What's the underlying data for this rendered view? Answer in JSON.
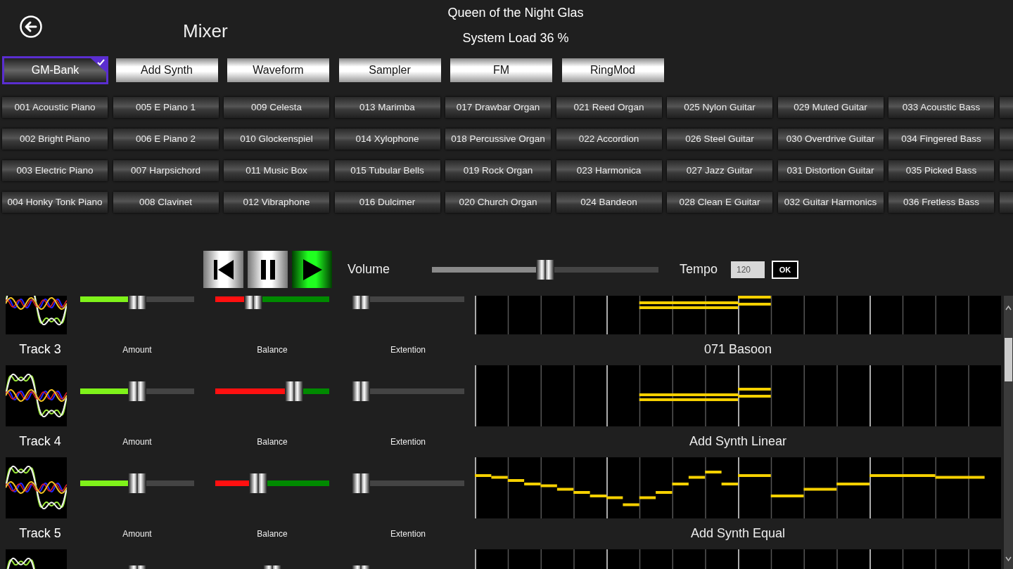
{
  "header": {
    "title": "Mixer",
    "song": "Queen of the Night Glas",
    "system_load": "System Load 36 %"
  },
  "tabs": [
    {
      "label": "GM-Bank",
      "selected": true
    },
    {
      "label": "Add Synth",
      "selected": false
    },
    {
      "label": "Waveform",
      "selected": false
    },
    {
      "label": "Sampler",
      "selected": false
    },
    {
      "label": "FM",
      "selected": false
    },
    {
      "label": "RingMod",
      "selected": false
    }
  ],
  "instrument_rows": [
    [
      "001 Acoustic Piano",
      "005 E Piano 1",
      "009 Celesta",
      "013 Marimba",
      "017 Drawbar Organ",
      "021 Reed Organ",
      "025 Nylon Guitar",
      "029 Muted Guitar",
      "033 Acoustic Bass"
    ],
    [
      "002 Bright Piano",
      "006 E Piano 2",
      "010 Glockenspiel",
      "014 Xylophone",
      "018 Percussive Organ",
      "022 Accordion",
      "026 Steel Guitar",
      "030 Overdrive Guitar",
      "034 Fingered Bass"
    ],
    [
      "003 Electric Piano",
      "007 Harpsichord",
      "011 Music Box",
      "015 Tubular Bells",
      "019 Rock Organ",
      "023 Harmonica",
      "027 Jazz Guitar",
      "031 Distortion Guitar",
      "035 Picked Bass"
    ],
    [
      "004 Honky Tonk Piano",
      "008 Clavinet",
      "012 Vibraphone",
      "016 Dulcimer",
      "020 Church Organ",
      "024 Bandeon",
      "028 Clean E Guitar",
      "032 Guitar Harmonics",
      "036 Fretless Bass"
    ]
  ],
  "transport": {
    "buttons": [
      {
        "kind": "previous",
        "active": false
      },
      {
        "kind": "pause",
        "active": false
      },
      {
        "kind": "play",
        "active": true
      }
    ],
    "volume": {
      "label": "Volume",
      "level": 0.5
    },
    "tempo": {
      "label": "Tempo",
      "value": "120",
      "button": "OK"
    }
  },
  "tracks": [
    {
      "amount": {
        "level": 0.5
      },
      "balance": {
        "level": 0.3
      },
      "extention": {
        "level": 0
      },
      "kind": "chords"
    },
    {
      "name": "Track 3",
      "instrument": "071 Basoon",
      "amount": {
        "label": "Amount",
        "level": 0.5
      },
      "balance": {
        "label": "Balance",
        "level": 0.73
      },
      "extention": {
        "label": "Extention",
        "level": 0
      },
      "kind": "chords"
    },
    {
      "name": "Track 4",
      "instrument": "Add Synth Linear",
      "amount": {
        "label": "Amount",
        "level": 0.5
      },
      "balance": {
        "label": "Balance",
        "level": 0.35
      },
      "extention": {
        "label": "Extention",
        "level": 0
      },
      "kind": "melody"
    },
    {
      "name": "Track 5",
      "instrument": "Add Synth Equal",
      "amount": {
        "label": "Amount",
        "level": 0.5
      },
      "balance": {
        "label": "Balance",
        "level": 0.5
      },
      "extention": {
        "label": "Extention",
        "level": 0
      },
      "kind": "empty"
    }
  ]
}
